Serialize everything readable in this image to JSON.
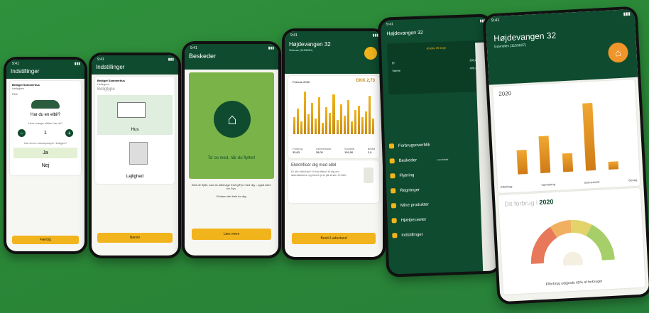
{
  "colors": {
    "background": "#2d8a3a",
    "brand_green": "#0f4b2f",
    "accent_yellow": "#f2b41c"
  },
  "phone1": {
    "time": "9:41",
    "title": "Indstillinger",
    "option_title": "Bediget Sommerhus",
    "option_sub": "Hellegren",
    "el_label": "Elbil",
    "question": "Har du en elbil?",
    "sub_question": "Hvor mange elbiler har du?",
    "count": "1",
    "minus": "−",
    "plus": "+",
    "sub_question2": "Har du en varmepumpe i boligen?",
    "yes": "Ja",
    "no": "Nej",
    "continue": "Færdig"
  },
  "phone2": {
    "time": "9:41",
    "title": "Indstillinger",
    "option_title": "Bediget Sommerhus",
    "option_sub": "Hellegren",
    "section": "Boligtype",
    "house": "Hus",
    "apartment": "Lejlighed",
    "continue": "Næste"
  },
  "phone3": {
    "time": "9:41",
    "title": "Beskeder",
    "headline": "Ta' os med, når du flytter!",
    "body": "Bed de flytte, kan du altid tage EnergiFyn med dig – også uden for Fyn.",
    "body2": "Vi klarer det hele for dig.",
    "button": "Læs mere"
  },
  "phone4": {
    "time": "9:41",
    "address": "Højdevangen 32",
    "sub": "Odense (1153450)",
    "month": "Februar 2020",
    "price_label": "DKK 2,73",
    "stats": [
      {
        "label": "Forbrug",
        "value": "35,63"
      },
      {
        "label": "Gennemsnit",
        "value": "28,05"
      },
      {
        "label": "Solcelle",
        "value": "159,50"
      },
      {
        "label": "Bedst",
        "value": "3,0"
      }
    ],
    "card_title": "Elektrificér dig med elbil",
    "card_text": "Er din elbil klar? Vi har tilbud til dig om ladestandere og bedre pris på strøm til elbil.",
    "button": "Bestil Ladestand",
    "chart_data": {
      "type": "bar",
      "values": [
        12,
        18,
        9,
        30,
        14,
        22,
        11,
        26,
        8,
        19,
        15,
        28,
        10,
        21,
        13,
        24,
        9,
        17,
        20,
        12,
        16,
        27,
        11
      ]
    }
  },
  "phone5": {
    "time": "9:41",
    "address": "Højdevangen 32",
    "highlight": "Ændre 20 ange",
    "row1_label": "El",
    "row1_value": "300,63 kr",
    "row2_label": "Varme",
    "row2_value": "409,29 kr",
    "menu": [
      {
        "label": "Forbrugsoverblik"
      },
      {
        "label": "Beskeder",
        "badge": "1 ny besked"
      },
      {
        "label": "Flytning"
      },
      {
        "label": "Regninger"
      },
      {
        "label": "Mine produkter"
      },
      {
        "label": "Hjælpecenter"
      },
      {
        "label": "Indstillinger"
      }
    ]
  },
  "phone6": {
    "time": "9:41",
    "address": "Højdevangen 32",
    "sub": "Gavnelev (1153607)",
    "year": "2020",
    "categories": [
      "Elforbrug",
      "Varmebrug",
      "Gennemsnit",
      "Besøg"
    ],
    "headline_prefix": "Dit forbrug i",
    "headline_year": "2020",
    "gauge_caption": "Elforbrug udgjorde 65% af forbruget",
    "chart_data": {
      "type": "bar",
      "values": [
        25,
        38,
        19,
        70,
        8
      ]
    }
  }
}
